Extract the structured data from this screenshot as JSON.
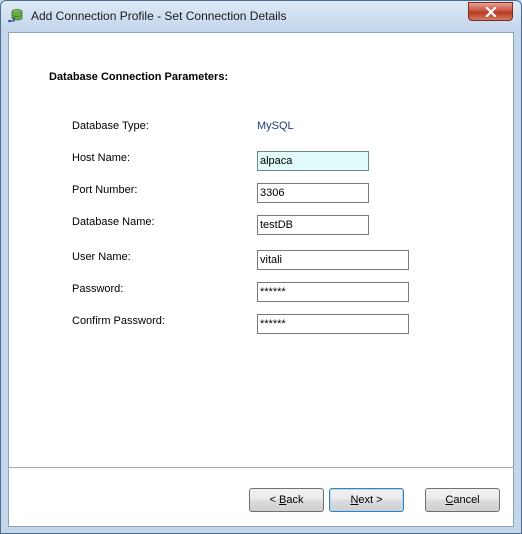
{
  "window": {
    "title": "Add Connection Profile - Set Connection Details"
  },
  "form": {
    "heading": "Database Connection Parameters:",
    "db_type_label": "Database Type:",
    "db_type_value": "MySQL",
    "host_label": "Host Name:",
    "host_value": "alpaca",
    "port_label": "Port Number:",
    "port_value": "3306",
    "dbname_label": "Database Name:",
    "dbname_value": "testDB",
    "user_label": "User Name:",
    "user_value": "vitali",
    "password_label": "Password:",
    "password_value": "******",
    "confirm_label": "Confirm Password:",
    "confirm_value": "******"
  },
  "buttons": {
    "back_prefix": "< ",
    "back_mnemonic": "B",
    "back_rest": "ack",
    "next_mnemonic": "N",
    "next_rest": "ext >",
    "cancel_mnemonic": "C",
    "cancel_rest": "ancel"
  },
  "icons": {
    "title_icon": "database-connection-icon",
    "close_icon": "close-icon"
  }
}
